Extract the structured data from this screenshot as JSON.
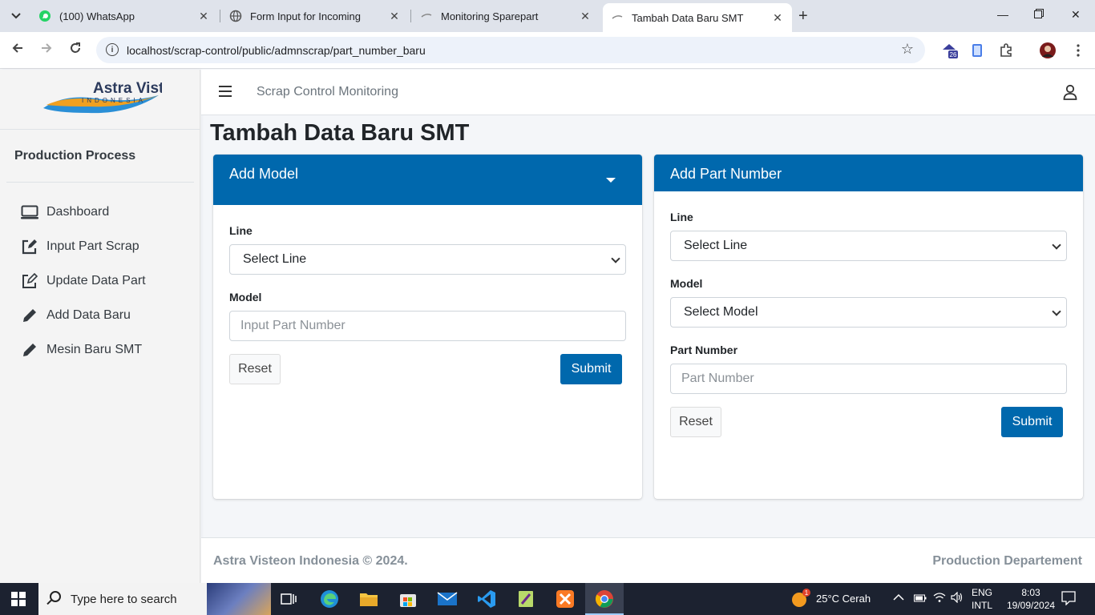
{
  "browser": {
    "tabs": [
      {
        "title": "(100) WhatsApp",
        "icon": "whatsapp-icon"
      },
      {
        "title": "Form Input for Incoming",
        "icon": "globe-icon"
      },
      {
        "title": "Monitoring Sparepart",
        "icon": "page-icon"
      },
      {
        "title": "Tambah Data Baru SMT",
        "icon": "page-icon",
        "active": true
      }
    ],
    "url": "localhost/scrap-control/public/admnscrap/part_number_baru",
    "extension_badge": "26"
  },
  "sidebar": {
    "brand_name": "Astra Visteon",
    "brand_sub": "INDONESIA",
    "section_title": "Production Process",
    "items": [
      {
        "label": "Dashboard",
        "icon": "monitor-icon"
      },
      {
        "label": "Input Part Scrap",
        "icon": "edit-icon"
      },
      {
        "label": "Update Data Part",
        "icon": "edit-icon"
      },
      {
        "label": "Add Data Baru",
        "icon": "pen-icon"
      },
      {
        "label": "Mesin Baru SMT",
        "icon": "pen-icon"
      }
    ]
  },
  "navbar": {
    "title": "Scrap Control Monitoring"
  },
  "page": {
    "title": "Tambah Data Baru SMT"
  },
  "add_model": {
    "header": "Add Model",
    "line_label": "Line",
    "line_value": "Select Line",
    "model_label": "Model",
    "model_placeholder": "Input Part Number",
    "reset": "Reset",
    "submit": "Submit"
  },
  "add_part": {
    "header": "Add Part Number",
    "line_label": "Line",
    "line_value": "Select Line",
    "model_label": "Model",
    "model_value": "Select Model",
    "part_label": "Part Number",
    "part_placeholder": "Part Number",
    "reset": "Reset",
    "submit": "Submit"
  },
  "footer": {
    "left": "Astra Visteon Indonesia © 2024.",
    "right": "Production Departement"
  },
  "taskbar": {
    "search_placeholder": "Type here to search",
    "weather": "25°C  Cerah",
    "weather_badge": "1",
    "lang_top": "ENG",
    "lang_bottom": "INTL",
    "time": "8:03",
    "date": "19/09/2024"
  },
  "colors": {
    "primary": "#0068ad",
    "footer_text": "#869099"
  }
}
